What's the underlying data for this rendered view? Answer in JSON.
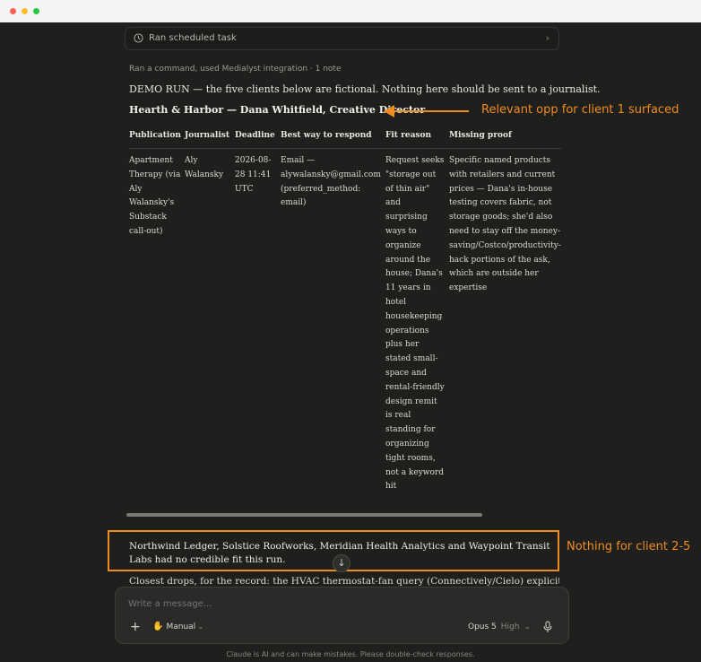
{
  "task_bar": {
    "label": "Ran scheduled task",
    "chevron": "›"
  },
  "message": {
    "meta": "Ran a command, used Medialyst integration · 1 note",
    "demo_notice": "DEMO RUN — the five clients below are fictional. Nothing here should be sent to a journalist.",
    "heading": "Hearth & Harbor — Dana Whitfield, Creative Director",
    "table": {
      "headers": [
        "Publication",
        "Journalist",
        "Deadline",
        "Best way to respond",
        "Fit reason",
        "Missing proof"
      ],
      "row": [
        "Apartment Therapy (via Aly Walansky's Substack call-out)",
        "Aly Walansky",
        "2026-08-28 11:41 UTC",
        "Email — alywalansky@gmail.com (preferred_method: email)",
        "Request seeks \"storage out of thin air\" and surprising ways to organize around the house; Dana's 11 years in hotel housekeeping operations plus her stated small-space and rental-friendly design remit is real standing for organizing tight rooms, not a keyword hit",
        "Specific named products with retailers and current prices — Dana's in-house testing covers fabric, not storage goods; she'd also need to stay off the money-saving/Costco/productivity-hack portions of the ask, which are outside her expertise"
      ]
    },
    "no_fit": "Northwind Ledger, Solstice Roofworks, Meridian Health Analytics and Waypoint Transit Labs had no credible fit this run.",
    "closest": "Closest drops, for the record: the HVAC thermostat-fan query (Connectively/Cielo) explicitly"
  },
  "annotations": {
    "opp": "Relevant opp for client 1 surfaced",
    "nothing": "Nothing for client 2-5"
  },
  "composer": {
    "placeholder": "Write a message...",
    "plus": "+",
    "mode": "Manual",
    "model": "Opus 5",
    "effort": "High",
    "caret": "⌄"
  },
  "footer": "Claude is AI and can make mistakes. Please double-check responses.",
  "colors": {
    "accent": "#f08c1e",
    "background": "#1f1f1e"
  }
}
